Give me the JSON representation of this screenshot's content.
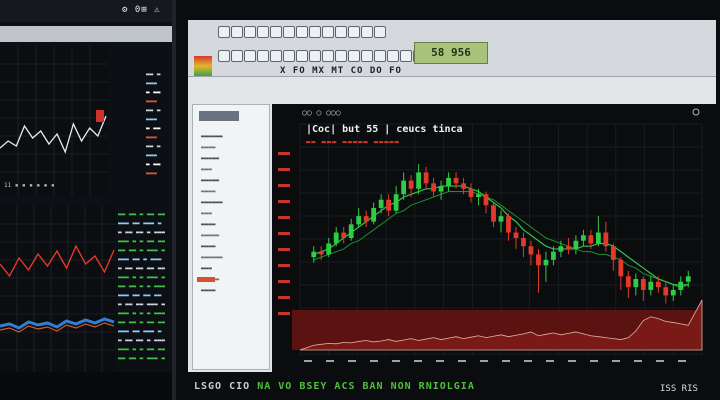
{
  "left_monitor": {
    "topbar_text": "⚙ 0⊞ ⚠",
    "list_a": [
      "▬▬ ▬",
      "▬▬▬",
      "▬ ▬▬",
      "▬▬▬",
      "▬▬ ▬",
      "▬▬▬",
      "▬ ▬▬",
      "▬▬▬",
      "▬▬ ▬",
      "▬▬▬",
      "▬ ▬▬",
      "▬▬▬"
    ],
    "list_b": [
      "▬▬ ▬▬ ▬",
      "▬▬▬ ▬▬",
      "▬ ▬▬ ▬▬",
      "▬▬▬ ▬ ▬",
      "▬▬ ▬▬ ▬",
      "▬▬▬ ▬▬",
      "▬ ▬▬ ▬▬",
      "▬▬▬ ▬ ▬",
      "▬▬ ▬▬ ▬",
      "▬▬▬ ▬▬",
      "▬ ▬▬ ▬▬",
      "▬▬▬ ▬ ▬",
      "▬▬ ▬▬ ▬",
      "▬▬▬ ▬▬",
      "▬ ▬▬ ▬▬",
      "▬▬▬ ▬ ▬",
      "▬▬ ▬▬ ▬"
    ],
    "list_c": [
      "▬▬ ▬▬",
      "▬▬▬ ▬",
      "▬ ▬▬▬",
      "▬▬ ▬▬",
      "▬▬▬ ▬",
      "▬ ▬▬▬",
      "▬▬ ▬▬",
      "▬▬▬ ▬",
      "▬ ▬▬▬",
      "▬▬ ▬▬",
      "▬▬▬ ▬",
      "▬ ▬▬▬",
      "▬▬ ▬▬",
      "▬▬▬ ▬",
      "▬ ▬▬▬",
      "▬▬ ▬▬",
      "▬▬▬ ▬"
    ],
    "tick_row": "11 ▪ ▪ ▪ ▪ ▪ ▪"
  },
  "main_app": {
    "ticker_display": "58 956",
    "menu_text": "X FO MX MT CO DO FO",
    "sidebar_items": [
      "▬▬▬▬▬▬",
      "▬▬▬▬",
      "▬▬▬▬▬",
      "▬▬▬",
      "▬▬▬▬▬",
      "▬▬▬▬",
      "▬▬▬▬▬▬",
      "▬▬▬",
      "▬▬▬▬",
      "▬▬▬▬▬",
      "▬▬▬▬",
      "▬▬▬▬▬▬",
      "▬▬▬",
      "▬▬▬▬▬",
      "▬▬▬▬"
    ],
    "chart_header_icons": "○○  ○  ○○○",
    "chart_title": "|Coc| but 55 | ceucs tinca",
    "chart_subtitle": "▬▬ ▬▬▬ ▬▬▬▬▬ ▬▬▬▬▬"
  },
  "chart_data": {
    "type": "candlestick",
    "up_color": "#2fcc45",
    "down_color": "#e23a2a",
    "ma_color": "#34c24a",
    "volume_color": "#7a1a16",
    "candles": [
      {
        "o": 43,
        "c": 45,
        "h": 47,
        "l": 41
      },
      {
        "o": 45,
        "c": 44,
        "h": 47,
        "l": 42
      },
      {
        "o": 44,
        "c": 48,
        "h": 50,
        "l": 43
      },
      {
        "o": 48,
        "c": 52,
        "h": 54,
        "l": 47
      },
      {
        "o": 52,
        "c": 50,
        "h": 54,
        "l": 48
      },
      {
        "o": 50,
        "c": 55,
        "h": 57,
        "l": 49
      },
      {
        "o": 55,
        "c": 58,
        "h": 61,
        "l": 54
      },
      {
        "o": 58,
        "c": 56,
        "h": 60,
        "l": 54
      },
      {
        "o": 56,
        "c": 61,
        "h": 63,
        "l": 55
      },
      {
        "o": 61,
        "c": 64,
        "h": 66,
        "l": 59
      },
      {
        "o": 64,
        "c": 60,
        "h": 66,
        "l": 58
      },
      {
        "o": 60,
        "c": 66,
        "h": 69,
        "l": 59
      },
      {
        "o": 66,
        "c": 71,
        "h": 74,
        "l": 64
      },
      {
        "o": 71,
        "c": 68,
        "h": 73,
        "l": 65
      },
      {
        "o": 68,
        "c": 74,
        "h": 77,
        "l": 66
      },
      {
        "o": 74,
        "c": 70,
        "h": 76,
        "l": 68
      },
      {
        "o": 70,
        "c": 67,
        "h": 72,
        "l": 65
      },
      {
        "o": 67,
        "c": 69,
        "h": 71,
        "l": 64
      },
      {
        "o": 69,
        "c": 72,
        "h": 74,
        "l": 67
      },
      {
        "o": 72,
        "c": 70,
        "h": 74,
        "l": 68
      },
      {
        "o": 70,
        "c": 68,
        "h": 72,
        "l": 66
      },
      {
        "o": 68,
        "c": 65,
        "h": 70,
        "l": 63
      },
      {
        "o": 65,
        "c": 66,
        "h": 68,
        "l": 62
      },
      {
        "o": 66,
        "c": 62,
        "h": 67,
        "l": 59
      },
      {
        "o": 62,
        "c": 56,
        "h": 63,
        "l": 54
      },
      {
        "o": 56,
        "c": 58,
        "h": 60,
        "l": 52
      },
      {
        "o": 58,
        "c": 52,
        "h": 59,
        "l": 49
      },
      {
        "o": 52,
        "c": 50,
        "h": 54,
        "l": 46
      },
      {
        "o": 50,
        "c": 47,
        "h": 52,
        "l": 43
      },
      {
        "o": 47,
        "c": 44,
        "h": 49,
        "l": 40
      },
      {
        "o": 44,
        "c": 40,
        "h": 46,
        "l": 30
      },
      {
        "o": 40,
        "c": 42,
        "h": 45,
        "l": 34
      },
      {
        "o": 42,
        "c": 45,
        "h": 47,
        "l": 40
      },
      {
        "o": 45,
        "c": 47,
        "h": 49,
        "l": 43
      },
      {
        "o": 47,
        "c": 46,
        "h": 50,
        "l": 44
      },
      {
        "o": 46,
        "c": 49,
        "h": 51,
        "l": 44
      },
      {
        "o": 49,
        "c": 51,
        "h": 53,
        "l": 47
      },
      {
        "o": 51,
        "c": 48,
        "h": 53,
        "l": 46
      },
      {
        "o": 48,
        "c": 52,
        "h": 58,
        "l": 47
      },
      {
        "o": 52,
        "c": 47,
        "h": 56,
        "l": 45
      },
      {
        "o": 47,
        "c": 42,
        "h": 48,
        "l": 38
      },
      {
        "o": 42,
        "c": 36,
        "h": 43,
        "l": 31
      },
      {
        "o": 36,
        "c": 32,
        "h": 38,
        "l": 28
      },
      {
        "o": 32,
        "c": 35,
        "h": 37,
        "l": 29
      },
      {
        "o": 35,
        "c": 31,
        "h": 36,
        "l": 27
      },
      {
        "o": 31,
        "c": 34,
        "h": 36,
        "l": 29
      },
      {
        "o": 34,
        "c": 32,
        "h": 36,
        "l": 30
      },
      {
        "o": 32,
        "c": 29,
        "h": 34,
        "l": 26
      },
      {
        "o": 29,
        "c": 31,
        "h": 33,
        "l": 27
      },
      {
        "o": 31,
        "c": 34,
        "h": 36,
        "l": 29
      },
      {
        "o": 34,
        "c": 36,
        "h": 38,
        "l": 32
      }
    ],
    "ma_fast": [
      44,
      45,
      46,
      48,
      50,
      52,
      54,
      56,
      58,
      60,
      62,
      63,
      65,
      66,
      67,
      68,
      68,
      69,
      69,
      69,
      69,
      68,
      67,
      65,
      63,
      61,
      58,
      56,
      53,
      51,
      49,
      47,
      46,
      46,
      46,
      46,
      47,
      47,
      48,
      48,
      47,
      45,
      43,
      41,
      39,
      37,
      35,
      34,
      33,
      32,
      33
    ],
    "ma_slow": [
      42,
      43,
      44,
      45,
      46,
      48,
      49,
      51,
      53,
      55,
      57,
      59,
      60,
      62,
      63,
      64,
      65,
      66,
      67,
      67,
      67,
      67,
      66,
      65,
      64,
      62,
      60,
      58,
      56,
      54,
      52,
      50,
      49,
      48,
      47,
      46,
      45,
      45,
      44,
      44,
      43,
      42,
      40,
      39,
      37,
      36,
      35,
      34,
      33,
      33,
      33
    ],
    "volume": [
      10,
      12,
      14,
      13,
      16,
      15,
      18,
      20,
      17,
      19,
      22,
      18,
      21,
      24,
      20,
      23,
      26,
      22,
      25,
      28,
      24,
      27,
      30,
      26,
      29,
      32,
      28,
      31,
      34,
      38,
      30,
      33,
      36,
      32,
      35,
      38,
      34,
      30,
      28,
      26,
      24,
      22,
      26,
      40,
      62,
      70,
      66,
      60,
      58,
      55,
      52
    ],
    "left_chart1_line": [
      62,
      55,
      60,
      40,
      52,
      45,
      58,
      48,
      66,
      38,
      55,
      42,
      50,
      30
    ],
    "left_chart2_red": [
      58,
      70,
      52,
      64,
      48,
      60,
      45,
      62,
      40,
      58,
      50,
      66,
      44
    ],
    "left_chart2_blue": [
      20,
      22,
      18,
      24,
      21,
      23,
      19,
      25,
      22,
      26,
      23,
      27,
      24
    ]
  },
  "bottom": {
    "caption_a": "LSGO CIO",
    "caption_b": "NA VO BSEY ACS BAN NON RNIOLGIA",
    "caption_right": "ISS RIS"
  }
}
